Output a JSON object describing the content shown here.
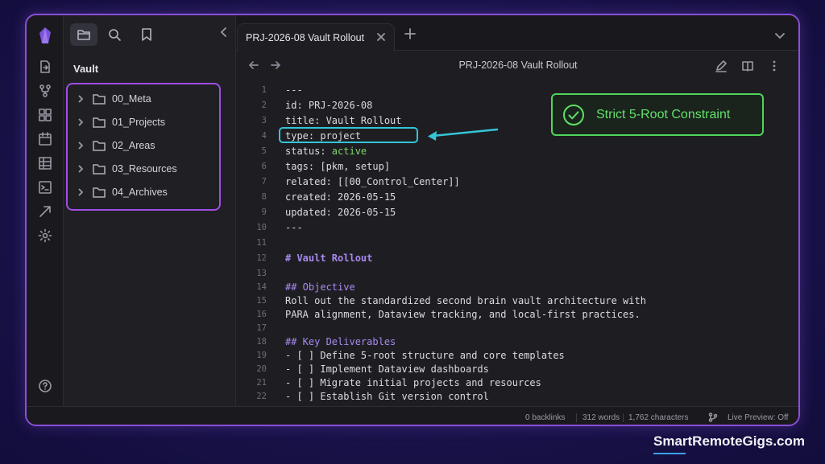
{
  "sidebar": {
    "title": "Vault",
    "folders": [
      "00_Meta",
      "01_Projects",
      "02_Areas",
      "03_Resources",
      "04_Archives"
    ]
  },
  "tab": {
    "title": "PRJ-2026-08 Vault Rollout"
  },
  "view": {
    "title": "PRJ-2026-08 Vault Rollout"
  },
  "editor": {
    "line_numbers": [
      "1",
      "2",
      "3",
      "4",
      "5",
      "6",
      "7",
      "8",
      "9",
      "10",
      "11",
      "12",
      "13",
      "14",
      "15",
      "16",
      "17",
      "18",
      "19",
      "20",
      "21",
      "22"
    ],
    "lines": {
      "l1": "---",
      "l2": "id: PRJ-2026-08",
      "l3": "title: Vault Rollout",
      "l4": "type: project",
      "l5_key": "status: ",
      "l5_val": "active",
      "l6": "tags: [pkm, setup]",
      "l7": "related: [[00_Control_Center]]",
      "l8": "created: 2026-05-15",
      "l9": "updated: 2026-05-15",
      "l10": "---",
      "l12": "# Vault Rollout",
      "l14": "## Objective",
      "l15": "Roll out the standardized second brain vault architecture with",
      "l16": "PARA alignment, Dataview tracking, and local-first practices.",
      "l18": "## Key Deliverables",
      "l19": "- [ ] Define 5-root structure and core templates",
      "l20": "- [ ] Implement Dataview dashboards",
      "l21": "- [ ] Migrate initial projects and resources",
      "l22": "- [ ] Establish Git version control"
    }
  },
  "callout": {
    "text": "Strict 5-Root Constraint"
  },
  "status": {
    "backlinks": "0 backlinks",
    "words": "312 words",
    "characters": "1,762 characters",
    "live_preview": "Live Preview: Off"
  },
  "brand": {
    "text": "SmartRemoteGigs.com"
  },
  "colors": {
    "accent_purple": "#a04ee6",
    "highlight_cyan": "#35c4d6",
    "callout_green": "#4fd65a"
  }
}
